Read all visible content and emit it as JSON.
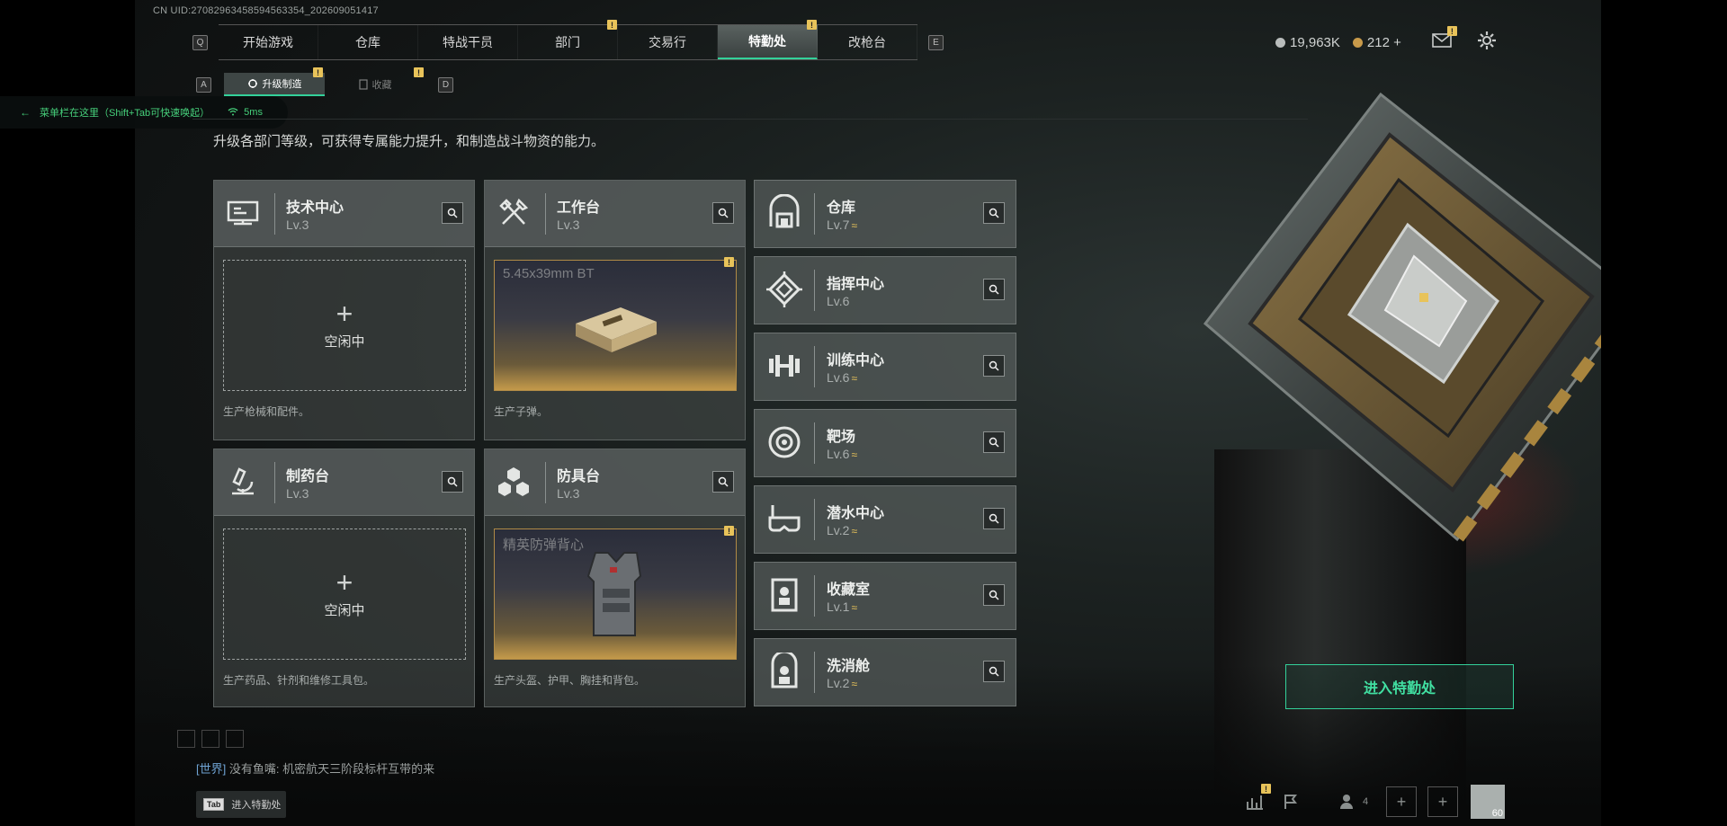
{
  "uid": "CN UID:27082963458594563354_202609051417",
  "top_tabs": [
    {
      "label": "开始游戏",
      "active": false,
      "badge": ""
    },
    {
      "label": "仓库",
      "active": false,
      "badge": ""
    },
    {
      "label": "特战干员",
      "active": false,
      "badge": ""
    },
    {
      "label": "部门",
      "active": false,
      "badge": "!"
    },
    {
      "label": "交易行",
      "active": false,
      "badge": ""
    },
    {
      "label": "特勤处",
      "active": true,
      "badge": "!"
    },
    {
      "label": "改枪台",
      "active": false,
      "badge": ""
    }
  ],
  "keys": {
    "prev": "Q",
    "next": "E",
    "sub_prev": "A",
    "sub_next": "D"
  },
  "sub_tabs": [
    {
      "label": "升级制造",
      "active": true,
      "badge": "!"
    },
    {
      "label": "收藏",
      "active": false,
      "badge": "!"
    }
  ],
  "notice": {
    "text": "菜单栏在这里（Shift+Tab可快速唤起）",
    "latency": "5ms"
  },
  "description": "升级各部门等级，可获得专属能力提升，和制造战斗物资的能力。",
  "currency": {
    "money": "19,963K",
    "coins": "212",
    "plus": "+",
    "money_color": "#b9bdbc",
    "coin_color": "#c89a4a",
    "mail_badge": "!"
  },
  "work_cards": [
    {
      "name": "技术中心",
      "level": "Lv.3",
      "status": "idle",
      "idle_label": "空闲中",
      "product": "",
      "caption": "生产枪械和配件。",
      "icon": "computer-icon"
    },
    {
      "name": "工作台",
      "level": "Lv.3",
      "status": "producing",
      "idle_label": "",
      "product": "5.45x39mm BT",
      "caption": "生产子弹。",
      "icon": "tools-icon",
      "badge": "!"
    },
    {
      "name": "制药台",
      "level": "Lv.3",
      "status": "idle",
      "idle_label": "空闲中",
      "product": "",
      "caption": "生产药品、针剂和维修工具包。",
      "icon": "microscope-icon"
    },
    {
      "name": "防具台",
      "level": "Lv.3",
      "status": "producing",
      "idle_label": "",
      "product": "精英防弹背心",
      "caption": "生产头盔、护甲、胸挂和背包。",
      "icon": "cubes-icon",
      "badge": "!"
    }
  ],
  "facilities": [
    {
      "name": "仓库",
      "level": "Lv.7",
      "upgradable": true,
      "icon": "warehouse-icon"
    },
    {
      "name": "指挥中心",
      "level": "Lv.6",
      "upgradable": false,
      "icon": "chip-icon"
    },
    {
      "name": "训练中心",
      "level": "Lv.6",
      "upgradable": true,
      "icon": "dumbbell-icon"
    },
    {
      "name": "靶场",
      "level": "Lv.6",
      "upgradable": true,
      "icon": "target-icon"
    },
    {
      "name": "潜水中心",
      "level": "Lv.2",
      "upgradable": true,
      "icon": "diving-mask-icon"
    },
    {
      "name": "收藏室",
      "level": "Lv.1",
      "upgradable": true,
      "icon": "display-case-icon"
    },
    {
      "name": "洗消舱",
      "level": "Lv.2",
      "upgradable": true,
      "icon": "decontamination-icon"
    }
  ],
  "upgrade_mark": "≈",
  "enter_button": "进入特勤处",
  "chat": {
    "channel": "[世界]",
    "message": "没有鱼嘴: 机密航天三阶段标杆互带的来"
  },
  "tab_hint": {
    "key": "Tab",
    "label": "进入特勤处"
  },
  "bottom_bar": {
    "friends_count": "4",
    "count_label": "60",
    "stats_badge": "!"
  }
}
